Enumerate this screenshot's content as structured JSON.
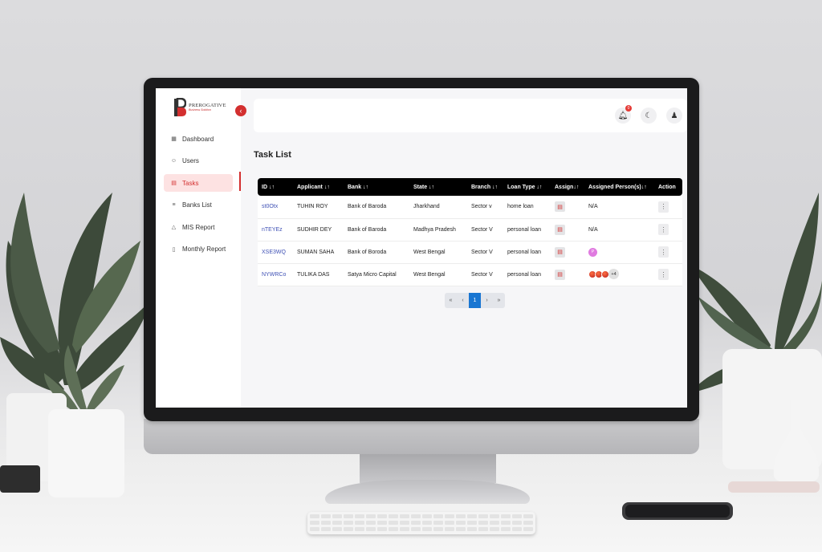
{
  "sidebar": {
    "logo": {
      "title": "PREROGATIVE",
      "subtitle": "Business Solution"
    },
    "items": [
      {
        "label": "Dashboard",
        "icon": "grid-icon"
      },
      {
        "label": "Users",
        "icon": "users-icon"
      },
      {
        "label": "Tasks",
        "icon": "clipboard-icon",
        "active": true
      },
      {
        "label": "Banks List",
        "icon": "bank-icon"
      },
      {
        "label": "MIS Report",
        "icon": "report-icon"
      },
      {
        "label": "Monthly Report",
        "icon": "tablet-icon"
      }
    ]
  },
  "topbar": {
    "notification_count": "0"
  },
  "page": {
    "title": "Task List"
  },
  "table": {
    "headers": [
      "ID ↓↑",
      "Applicant ↓↑",
      "Bank ↓↑",
      "State ↓↑",
      "Branch ↓↑",
      "Loan Type ↓↑",
      "Assign↓↑",
      "Assigned Person(s)↓↑",
      "Action"
    ],
    "rows": [
      {
        "id": "st0Otx",
        "applicant": "TUHIN ROY",
        "bank": "Bank of Baroda",
        "state": "Jharkhand",
        "branch": "Sector v",
        "loan_type": "home loan",
        "assigned": "N/A"
      },
      {
        "id": "nTEYEz",
        "applicant": "SUDHIR DEY",
        "bank": "Bank of Baroda",
        "state": "Madhya Pradesh",
        "branch": "Sector V",
        "loan_type": "personal loan",
        "assigned": "N/A"
      },
      {
        "id": "XSE3WQ",
        "applicant": "SUMAN SAHA",
        "bank": "Bank of Boroda",
        "state": "West Bengal",
        "branch": "Sector V",
        "loan_type": "personal loan",
        "assigned": "P"
      },
      {
        "id": "NYWRCo",
        "applicant": "TULIKA DAS",
        "bank": "Satya Micro Capital",
        "state": "West Bengal",
        "branch": "Sector V",
        "loan_type": "personal loan",
        "assigned": "+4"
      }
    ]
  },
  "pagination": {
    "first": "«",
    "prev": "‹",
    "current": "1",
    "next": "›",
    "last": "»"
  },
  "colors": {
    "accent": "#d32f2f",
    "link": "#3f51b5",
    "page_active": "#1976d2"
  }
}
